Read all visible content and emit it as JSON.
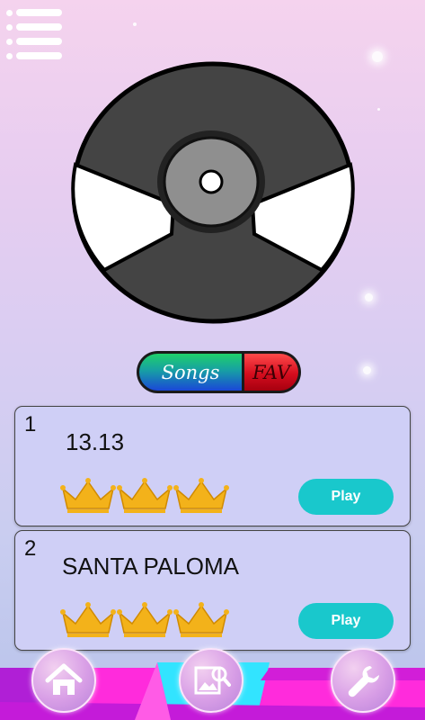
{
  "header": {
    "menu_icon": "hamburger-menu-icon"
  },
  "record": {
    "icon": "vinyl-record-icon"
  },
  "tabs": [
    {
      "label": "Songs",
      "active": true,
      "color": "#1a47d8"
    },
    {
      "label": "FAV",
      "active": false,
      "color": "#d40d1e"
    }
  ],
  "songs": [
    {
      "number": "1",
      "title": "13.13",
      "crowns": 3,
      "play_label": "Play"
    },
    {
      "number": "2",
      "title": "SANTA PALOMA",
      "crowns": 3,
      "play_label": "Play"
    }
  ],
  "bottom_nav": [
    {
      "name": "home",
      "icon": "home-icon"
    },
    {
      "name": "gallery",
      "icon": "image-search-icon"
    },
    {
      "name": "settings",
      "icon": "wrench-icon"
    }
  ],
  "colors": {
    "card_background": "#cfcff6",
    "play_button": "#19c8cc",
    "crown": "#f3b21a",
    "bar_magenta": "#ff2bdc",
    "bar_cyan": "#32e4ff"
  }
}
